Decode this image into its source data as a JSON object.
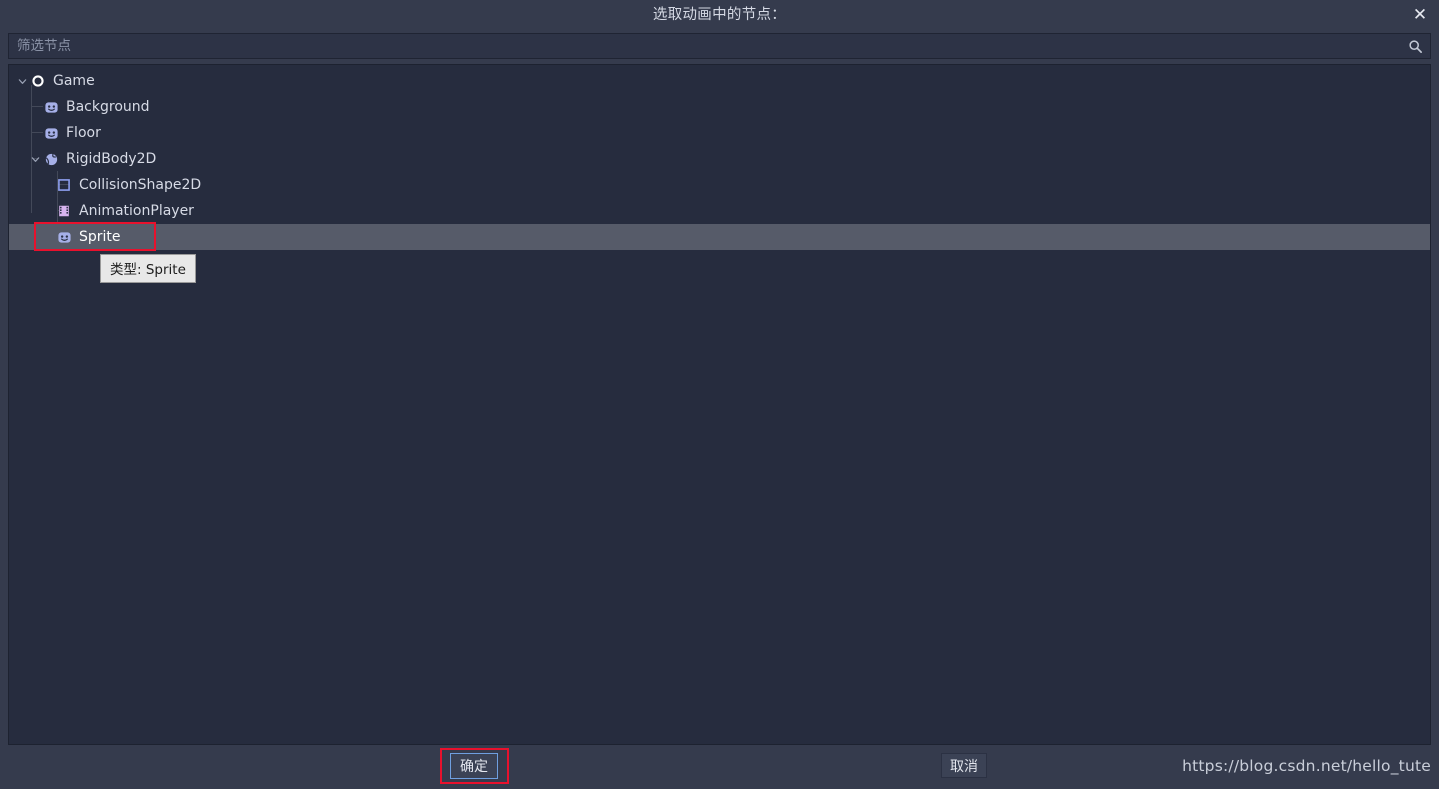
{
  "window": {
    "title": "选取动画中的节点：",
    "close_label": "✕"
  },
  "search": {
    "placeholder": "筛选节点",
    "value": "",
    "icon": "search-icon"
  },
  "tree": {
    "nodes": [
      {
        "label": "Game",
        "depth": 0,
        "icon": "node2d-icon",
        "expanded": true,
        "selected": false
      },
      {
        "label": "Background",
        "depth": 1,
        "icon": "sprite-icon",
        "expanded": null,
        "selected": false
      },
      {
        "label": "Floor",
        "depth": 1,
        "icon": "sprite-icon",
        "expanded": null,
        "selected": false
      },
      {
        "label": "RigidBody2D",
        "depth": 1,
        "icon": "rigidbody2d-icon",
        "expanded": true,
        "selected": false
      },
      {
        "label": "CollisionShape2D",
        "depth": 2,
        "icon": "collisionshape2d-icon",
        "expanded": null,
        "selected": false
      },
      {
        "label": "AnimationPlayer",
        "depth": 2,
        "icon": "animationplayer-icon",
        "expanded": null,
        "selected": false
      },
      {
        "label": "Sprite",
        "depth": 2,
        "icon": "sprite-icon",
        "expanded": null,
        "selected": true
      }
    ]
  },
  "tooltip": {
    "text": "类型: Sprite"
  },
  "footer": {
    "ok_label": "确定",
    "cancel_label": "取消"
  },
  "watermark": {
    "text": "https://blog.csdn.net/hello_tute"
  },
  "colors": {
    "dialog_bg": "#353b4d",
    "panel_bg": "#262c3e",
    "field_bg": "#2d3346",
    "selection": "#565b69",
    "text": "#d7dbe6",
    "accent_icon": "#a6b0e8",
    "annotation": "#e8112d",
    "focus_border": "#6f9fe0",
    "tooltip_bg": "#e8e8e8"
  }
}
